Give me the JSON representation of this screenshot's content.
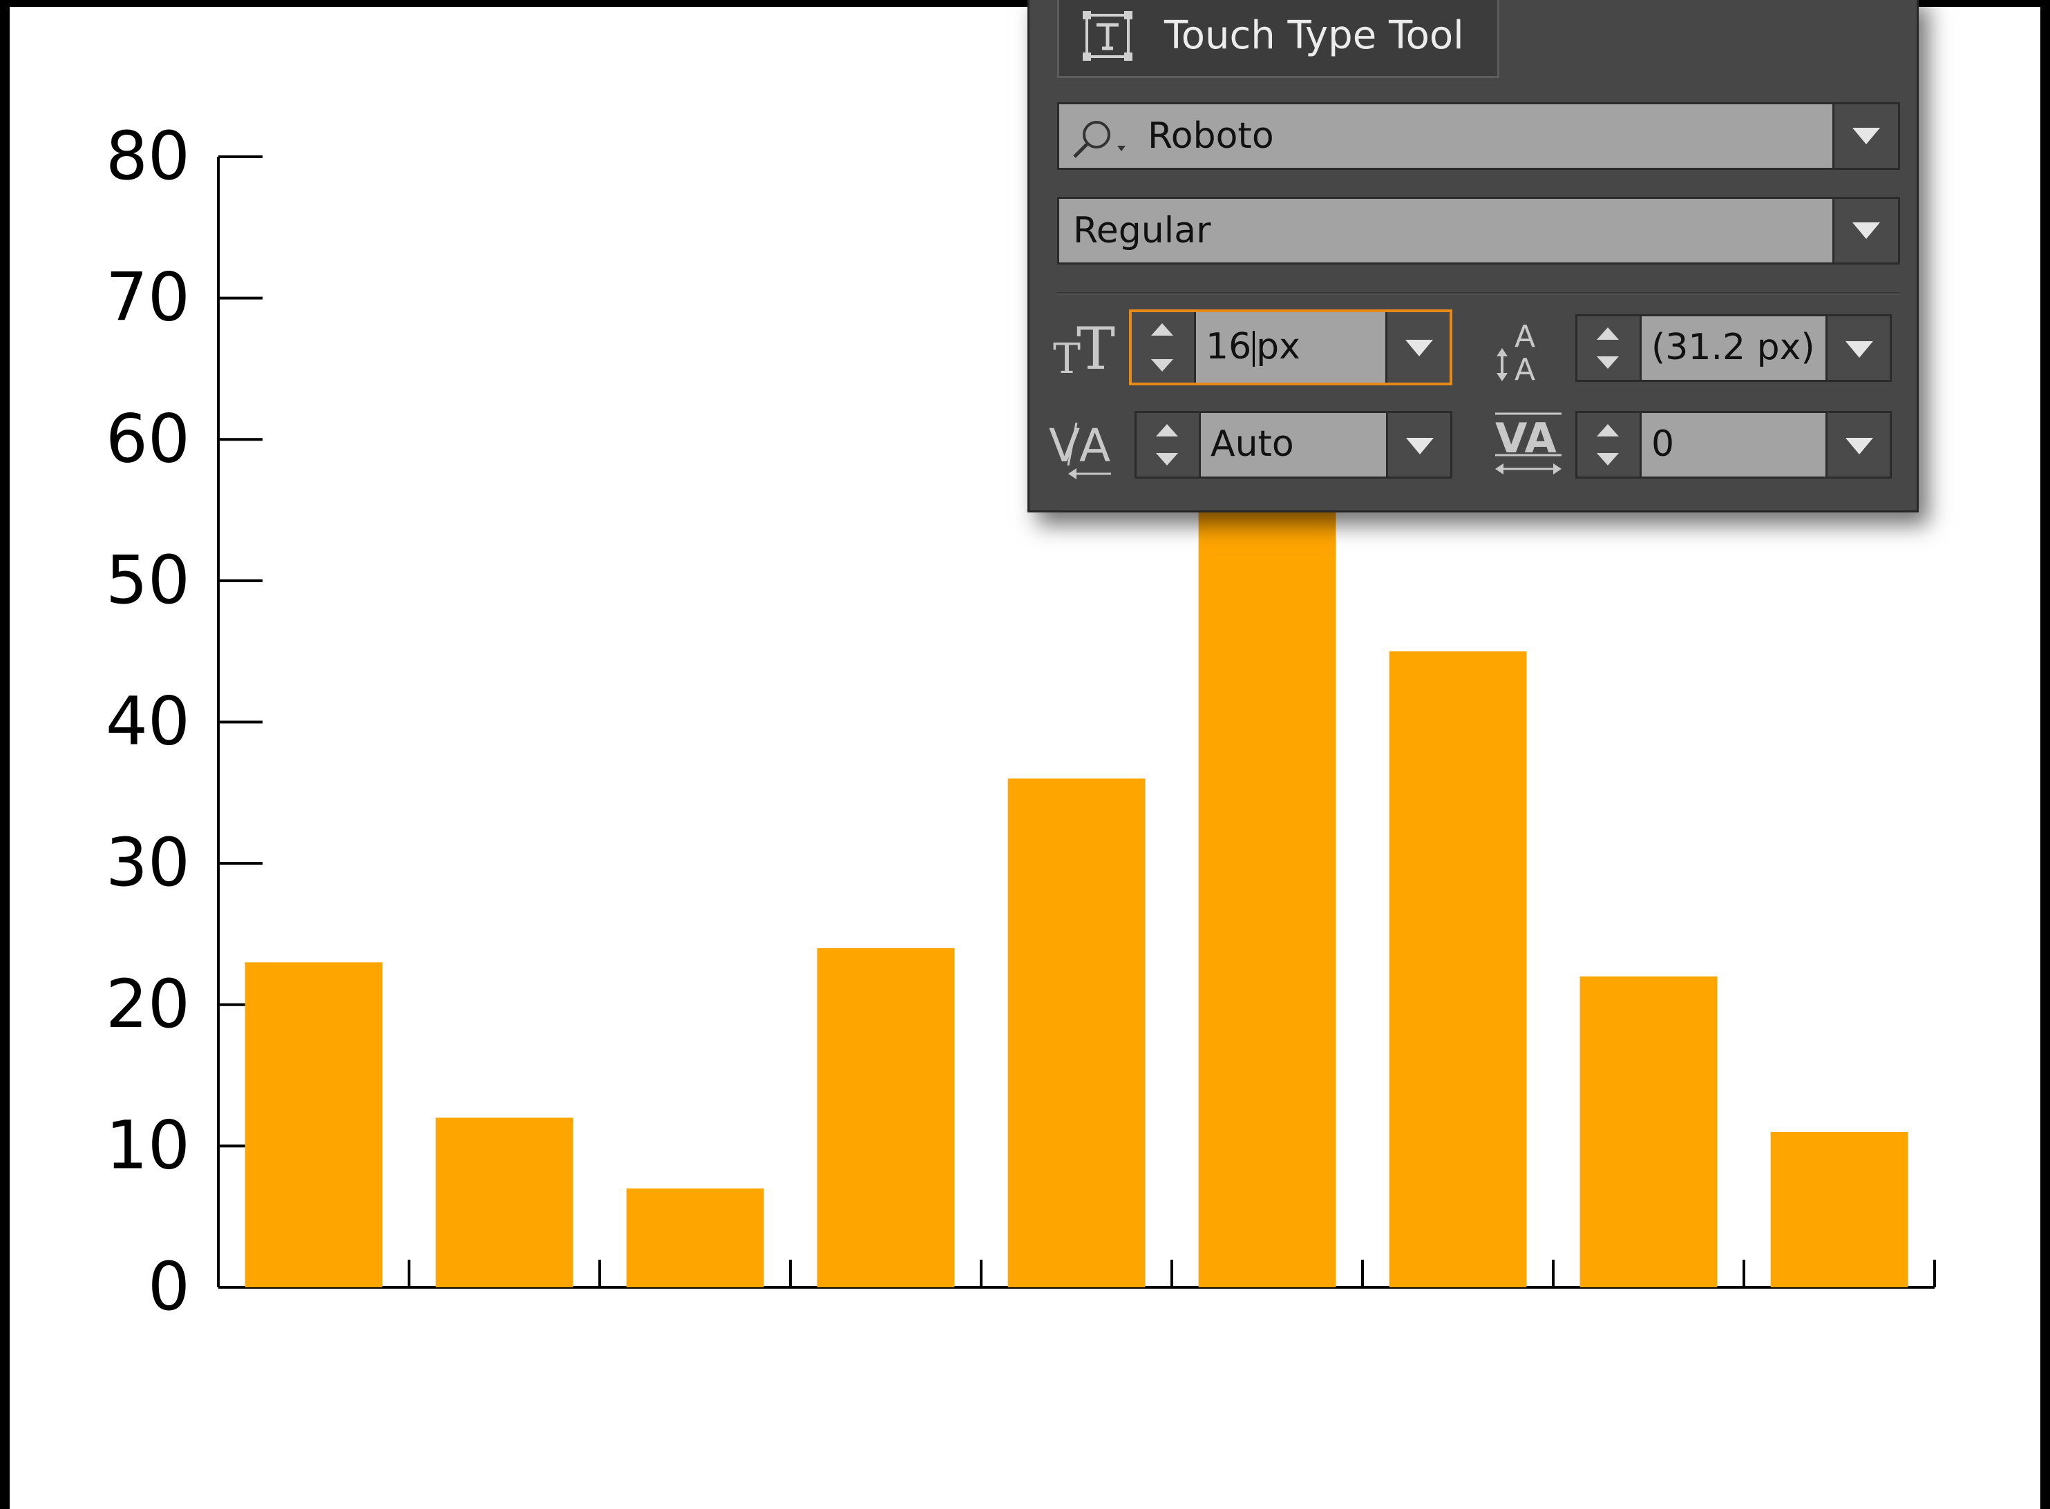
{
  "chart_data": {
    "type": "bar",
    "categories": [
      "",
      "",
      "",
      "",
      "",
      "",
      "",
      "",
      ""
    ],
    "values": [
      23,
      12,
      7,
      24,
      36,
      60,
      45,
      22,
      11
    ],
    "title": "",
    "xlabel": "",
    "ylabel": "",
    "ylim": [
      0,
      80
    ],
    "yticks": [
      0,
      10,
      20,
      30,
      40,
      50,
      60,
      70,
      80
    ],
    "bar_color": "#FFA500",
    "grid": false
  },
  "panel": {
    "tool_label": "Touch Type Tool",
    "font_family": "Roboto",
    "font_style": "Regular",
    "font_size_value": "16",
    "font_size_unit": "px",
    "leading_value": "(31.2 px)",
    "kerning_value": "Auto",
    "tracking_value": "0"
  },
  "colors": {
    "accent_focus": "#E88A1A",
    "panel_bg": "#474747",
    "canvas_bg": "#FFFFFF"
  },
  "icons": {
    "tool": "touch-type-icon",
    "search": "search-icon",
    "font_size": "font-size-icon",
    "leading": "leading-icon",
    "kerning": "kerning-icon",
    "tracking": "tracking-icon"
  }
}
